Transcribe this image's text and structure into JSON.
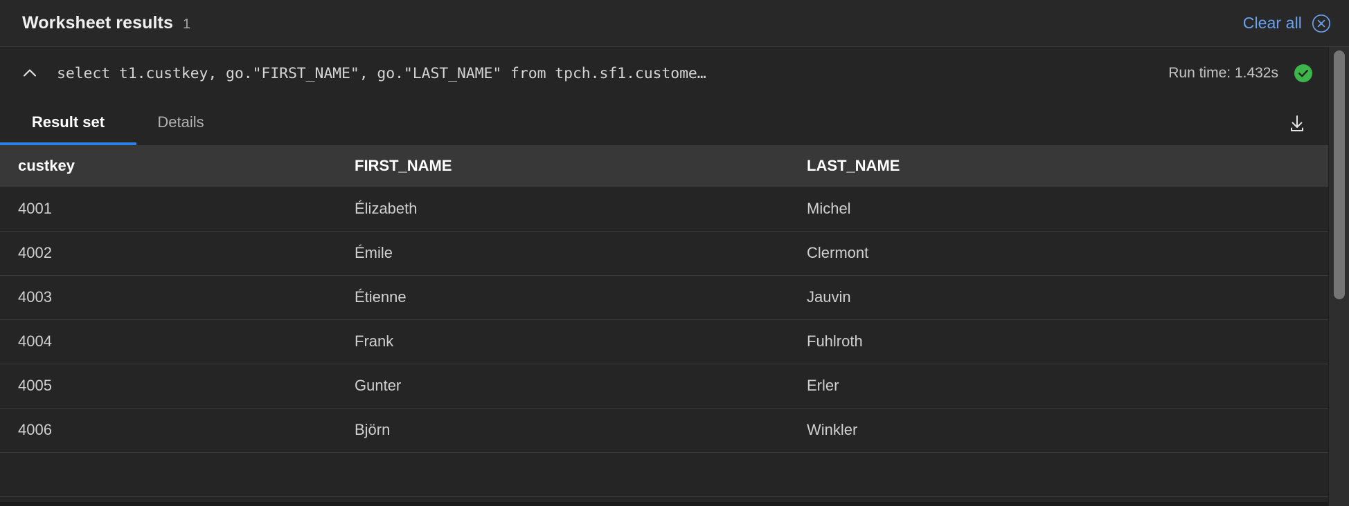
{
  "header": {
    "title": "Worksheet results",
    "count": "1",
    "clear_all_label": "Clear all",
    "clear_icon": "close-circle-icon",
    "accent_color": "#6ba1f0"
  },
  "query": {
    "collapse_icon": "chevron-up-icon",
    "text": "select t1.custkey, go.\"FIRST_NAME\", go.\"LAST_NAME\" from tpch.sf1.custome…",
    "run_time": "Run time: 1.432s",
    "status_icon": "check-circle-icon",
    "status_color": "#3cb54a"
  },
  "tabs": {
    "items": [
      {
        "label": "Result set",
        "active": true
      },
      {
        "label": "Details",
        "active": false
      }
    ],
    "active_underline_color": "#2f7fe8",
    "download_icon": "download-icon"
  },
  "table": {
    "columns": [
      "custkey",
      "FIRST_NAME",
      "LAST_NAME"
    ],
    "rows": [
      [
        "4001",
        "Élizabeth",
        "Michel"
      ],
      [
        "4002",
        "Émile",
        "Clermont"
      ],
      [
        "4003",
        "Étienne",
        "Jauvin"
      ],
      [
        "4004",
        "Frank",
        "Fuhlroth"
      ],
      [
        "4005",
        "Gunter",
        "Erler"
      ],
      [
        "4006",
        "Björn",
        "Winkler"
      ],
      [
        "",
        "",
        ""
      ]
    ]
  }
}
